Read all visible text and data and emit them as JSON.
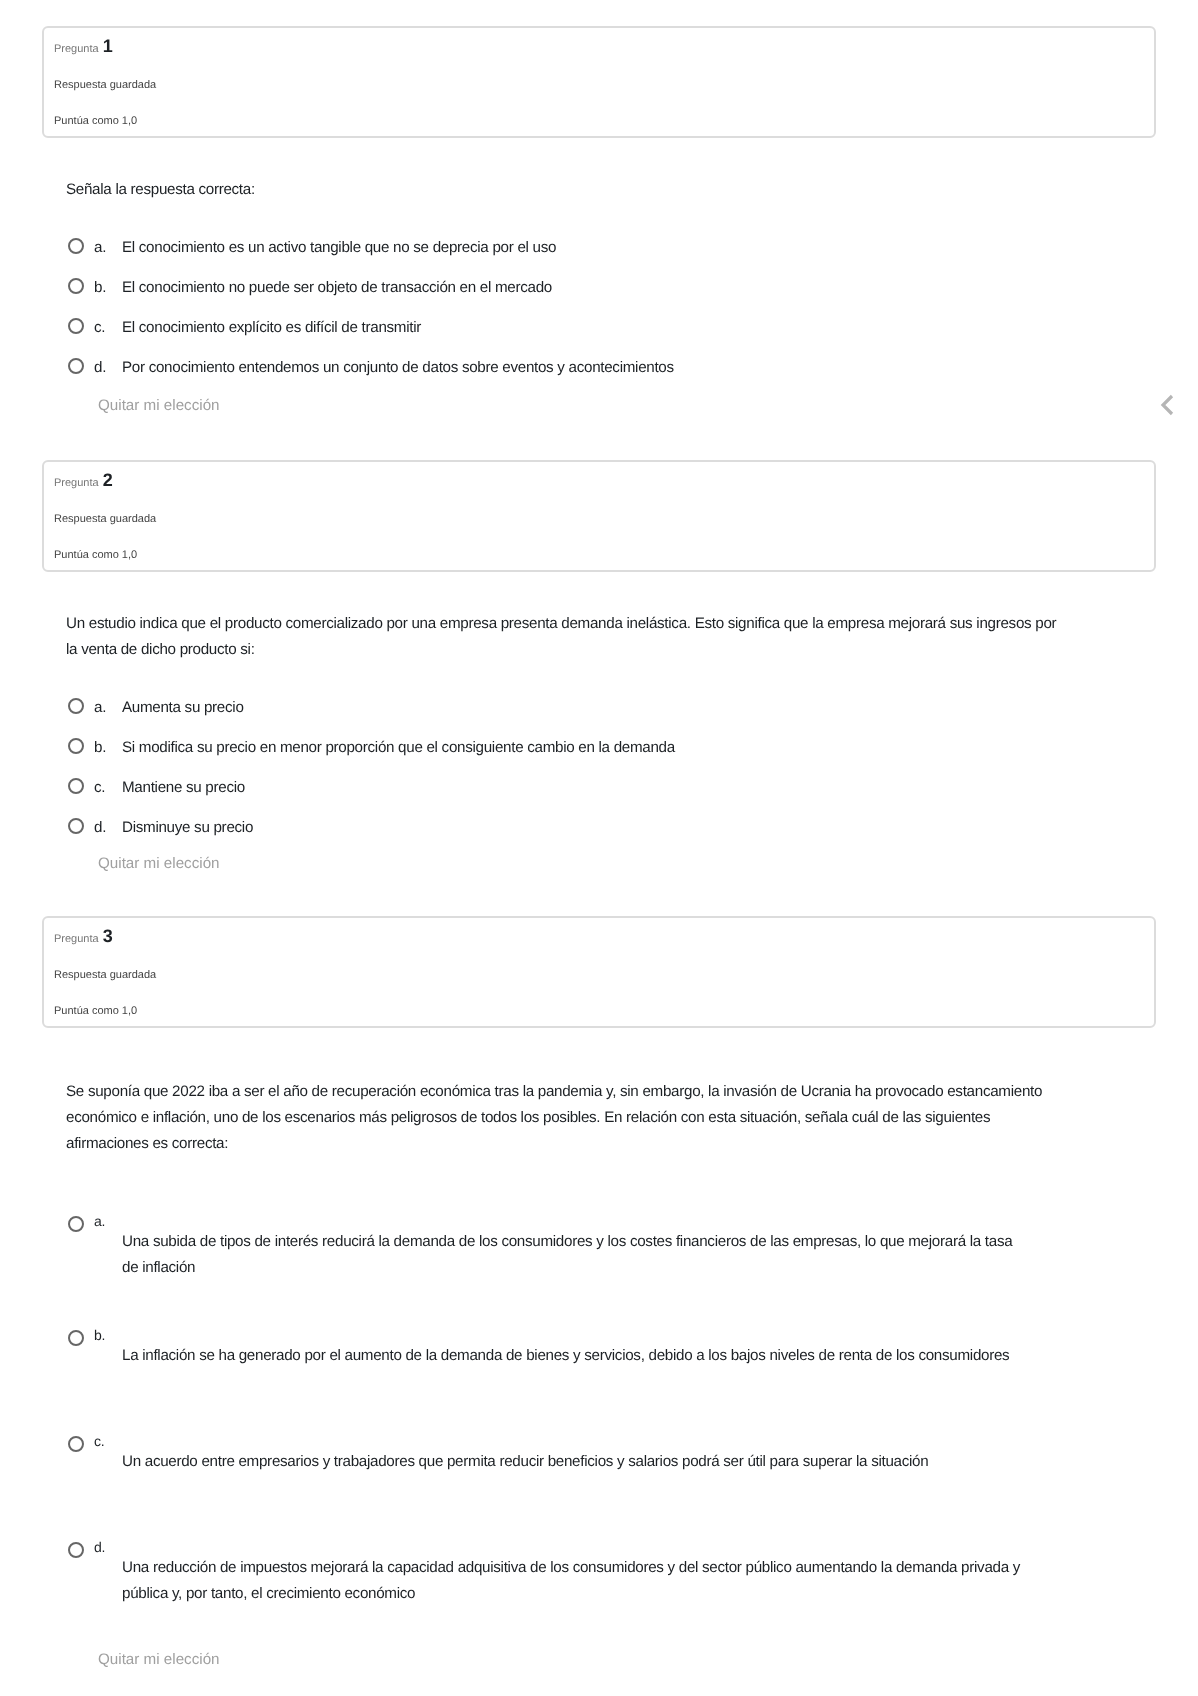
{
  "questions": [
    {
      "label": "Pregunta",
      "number": "1",
      "status": "Respuesta guardada",
      "score": "Puntúa como 1,0",
      "kind": "compact",
      "side_arrow": true,
      "text": "Señala la respuesta correcta:",
      "clear": "Quitar mi elección",
      "options": [
        {
          "letter": "a.",
          "text": "El conocimiento es un activo tangible que no se deprecia por el uso",
          "selected": false
        },
        {
          "letter": "b.",
          "text": "El conocimiento no puede ser objeto de transacción en el mercado",
          "selected": false
        },
        {
          "letter": "c.",
          "text": "El conocimiento explícito es difícil de transmitir",
          "selected": false
        },
        {
          "letter": "d.",
          "text": "Por conocimiento entendemos un conjunto de datos sobre eventos y acontecimientos",
          "selected": false
        }
      ]
    },
    {
      "label": "Pregunta",
      "number": "2",
      "status": "Respuesta guardada",
      "score": "Puntúa como 1,0",
      "kind": "compact",
      "text": "Un estudio indica que el producto comercializado por una empresa presenta demanda inelástica. Esto significa que la empresa mejorará sus ingresos por la venta de dicho producto si:",
      "clear": "Quitar mi elección",
      "options": [
        {
          "letter": "a.",
          "text": "Aumenta su precio",
          "selected": false
        },
        {
          "letter": "b.",
          "text": "Si modifica su precio en menor proporción que el consiguiente cambio en la demanda",
          "selected": false
        },
        {
          "letter": "c.",
          "text": "Mantiene su precio",
          "selected": false
        },
        {
          "letter": "d.",
          "text": "Disminuye su precio",
          "selected": false
        }
      ]
    },
    {
      "label": "Pregunta",
      "number": "3",
      "status": "Respuesta guardada",
      "score": "Puntúa como 1,0",
      "kind": "spaced",
      "text": "Se suponía que 2022 iba a ser el año de recuperación económica tras la pandemia y, sin embargo, la invasión de Ucrania ha provocado estancamiento económico e inflación, uno de los escenarios más peligrosos de todos los posibles. En relación con esta situación, señala cuál de las siguientes afirmaciones es correcta:",
      "clear": "Quitar mi elección",
      "options": [
        {
          "letter": "a.",
          "text": "Una subida de tipos de interés reducirá la demanda de los consumidores y los costes financieros de las empresas, lo que mejorará la tasa de inflación",
          "selected": false
        },
        {
          "letter": "b.",
          "text": "La inflación se ha generado por el aumento de la demanda de bienes y servicios, debido a los bajos niveles de renta de los consumidores",
          "selected": false
        },
        {
          "letter": "c.",
          "text": "Un acuerdo entre empresarios y trabajadores que permita reducir beneficios y salarios podrá ser útil para superar la situación",
          "selected": false
        },
        {
          "letter": "d.",
          "text": "Una reducción de impuestos mejorará la capacidad adquisitiva de los consumidores y del sector público aumentando la demanda privada y pública y, por tanto, el crecimiento económico",
          "selected": false
        }
      ]
    }
  ]
}
